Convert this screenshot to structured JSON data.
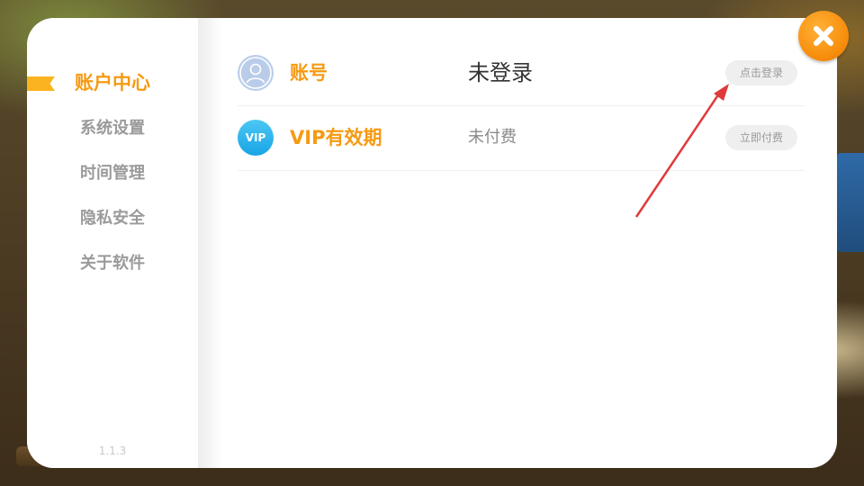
{
  "sidebar": {
    "items": [
      {
        "label": "账户中心",
        "active": true
      },
      {
        "label": "系统设置",
        "active": false
      },
      {
        "label": "时间管理",
        "active": false
      },
      {
        "label": "隐私安全",
        "active": false
      },
      {
        "label": "关于软件",
        "active": false
      }
    ],
    "version": "1.1.3"
  },
  "main": {
    "account": {
      "icon": "avatar-icon",
      "title": "账号",
      "value": "未登录",
      "button_label": "点击登录"
    },
    "vip": {
      "icon_text": "VIP",
      "title": "VIP有效期",
      "value": "未付费",
      "button_label": "立即付费"
    }
  },
  "close_icon": "close-icon",
  "colors": {
    "accent": "#f59a12",
    "marker": "#fcb320",
    "vip_icon": "#18a4e6",
    "annotation_arrow": "#e03a3a"
  }
}
